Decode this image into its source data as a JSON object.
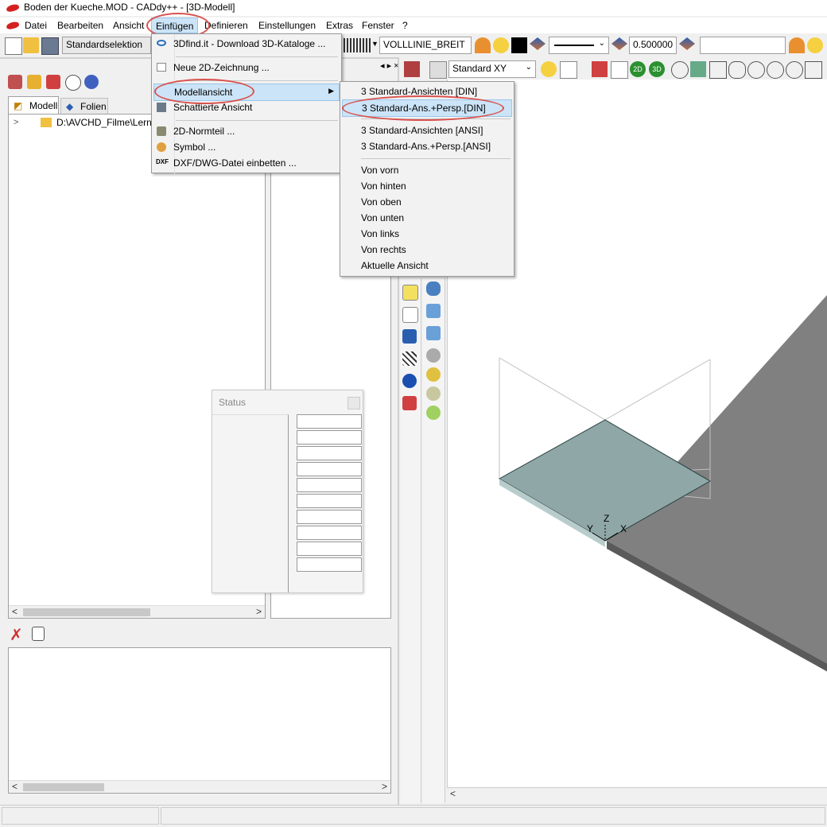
{
  "window": {
    "title": "Boden der Kueche.MOD  -  CADdy++ - [3D-Modell]"
  },
  "menubar": {
    "items": [
      "Datei",
      "Bearbeiten",
      "Ansicht",
      "Einfügen",
      "Definieren",
      "Einstellungen",
      "Extras",
      "Fenster",
      "?"
    ]
  },
  "toolbar": {
    "selection": "Standardselektion",
    "linetype": "VOLLLINIE_BREIT",
    "lineweight": "0.500000",
    "view": "Standard XY"
  },
  "left_panel": {
    "tabs": [
      "Modell",
      "Folien"
    ],
    "tree_path": "D:\\AVCHD_Filme\\Lern"
  },
  "einfuegen_menu": {
    "items": [
      "3Dfind.it - Download 3D-Kataloge ...",
      "Neue 2D-Zeichnung ...",
      "Modellansicht",
      "Schattierte Ansicht",
      "2D-Normteil ...",
      "Symbol ...",
      "DXF/DWG-Datei einbetten ..."
    ]
  },
  "modellansicht_submenu": {
    "items": [
      "3 Standard-Ansichten [DIN]",
      "3 Standard-Ans.+Persp.[DIN]",
      "3 Standard-Ansichten [ANSI]",
      "3 Standard-Ans.+Persp.[ANSI]",
      "Von vorn",
      "Von hinten",
      "Von oben",
      "Von unten",
      "Von links",
      "Von rechts",
      "Aktuelle Ansicht"
    ]
  },
  "status_window": {
    "title": "Status"
  },
  "viewport": {
    "axes": [
      "Y",
      "Z",
      "X"
    ]
  },
  "colors": {
    "accent_ring": "#d9534f",
    "highlight": "#cce4f7",
    "floor": "#808080",
    "plate": "#8fa7a7"
  }
}
